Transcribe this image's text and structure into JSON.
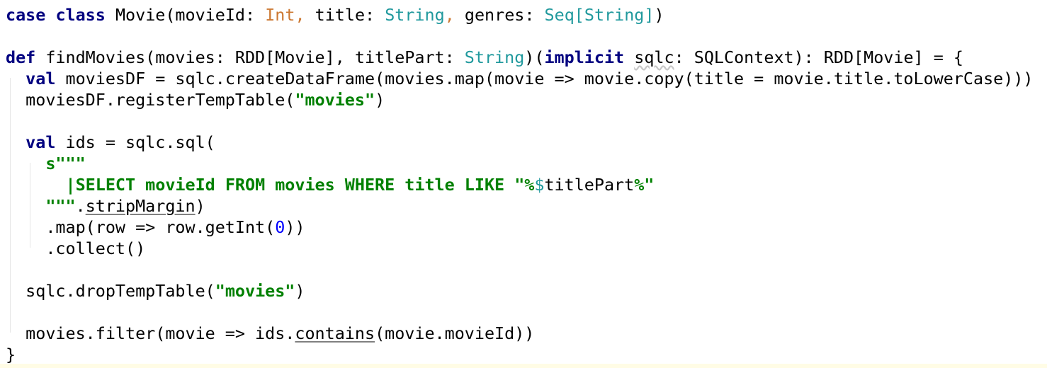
{
  "lines": [
    [
      {
        "t": "case",
        "c": "kw"
      },
      {
        "t": " "
      },
      {
        "t": "class",
        "c": "kw"
      },
      {
        "t": " Movie(movieId: "
      },
      {
        "t": "Int",
        "c": "builtin"
      },
      {
        "t": ", ",
        "c": "builtin"
      },
      {
        "t": "title: "
      },
      {
        "t": "String",
        "c": "type"
      },
      {
        "t": ", ",
        "c": "builtin"
      },
      {
        "t": "genres: "
      },
      {
        "t": "Seq[String]",
        "c": "type"
      },
      {
        "t": ")"
      }
    ],
    [],
    [
      {
        "t": "def",
        "c": "kw"
      },
      {
        "t": " findMovies(movies: RDD[Movie], titlePart: "
      },
      {
        "t": "String",
        "c": "type"
      },
      {
        "t": ")("
      },
      {
        "t": "implicit",
        "c": "kw"
      },
      {
        "t": " "
      },
      {
        "t": "sqlc",
        "c": "wavy"
      },
      {
        "t": ": SQLContext): RDD[Movie] = {"
      }
    ],
    [
      {
        "t": "  "
      },
      {
        "t": "val",
        "c": "kw"
      },
      {
        "t": " moviesDF = sqlc.createDataFrame(movies.map(movie => movie.copy(title = movie.title.toLowerCase)))"
      }
    ],
    [
      {
        "t": "  moviesDF.registerTempTable("
      },
      {
        "t": "\"movies\"",
        "c": "str"
      },
      {
        "t": ")"
      }
    ],
    [],
    [
      {
        "t": "  "
      },
      {
        "t": "val",
        "c": "kw"
      },
      {
        "t": " ids = sqlc.sql("
      }
    ],
    [
      {
        "t": "    "
      },
      {
        "t": "s\"\"\"",
        "c": "str"
      }
    ],
    [
      {
        "t": "      "
      },
      {
        "t": "|SELECT movieId FROM movies WHERE title LIKE \"%",
        "c": "str"
      },
      {
        "t": "$",
        "c": "interp"
      },
      {
        "t": "titlePart"
      },
      {
        "t": "%\"",
        "c": "str"
      }
    ],
    [
      {
        "t": "    "
      },
      {
        "t": "\"\"\"",
        "c": "str"
      },
      {
        "t": "."
      },
      {
        "t": "stripMargin",
        "c": "uline"
      },
      {
        "t": ")"
      }
    ],
    [
      {
        "t": "    .map(row => row.getInt("
      },
      {
        "t": "0",
        "c": "num"
      },
      {
        "t": "))"
      }
    ],
    [
      {
        "t": "    .collect()"
      }
    ],
    [],
    [
      {
        "t": "  sqlc.dropTempTable("
      },
      {
        "t": "\"movies\"",
        "c": "str"
      },
      {
        "t": ")"
      }
    ],
    [],
    [
      {
        "t": "  movies.filter(movie => ids."
      },
      {
        "t": "contains",
        "c": "uline"
      },
      {
        "t": "(movie.movieId))"
      }
    ],
    [
      {
        "t": "}"
      }
    ]
  ],
  "colors": {
    "keyword": "#000080",
    "type": "#20999d",
    "builtin": "#cc7832",
    "string": "#008000",
    "number": "#0000ff",
    "caret_line": "#fffce5"
  }
}
